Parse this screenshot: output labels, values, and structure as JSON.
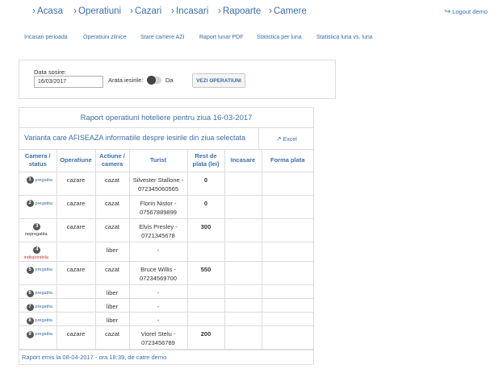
{
  "nav": {
    "items": [
      "Acasa",
      "Operatiuni",
      "Cazari",
      "Incasari",
      "Rapoarte",
      "Camere"
    ],
    "logout": "Logout demo"
  },
  "subnav": {
    "items": [
      "Incasari perioada",
      "Operatiuni zilnice",
      "Stare camere AZI",
      "Raport lunar PDF",
      "Statistica per luna",
      "Statistica luna vs. luna"
    ]
  },
  "filter": {
    "date_label": "Data sosire:",
    "date_value": "16/03/2017",
    "show_label": "Arata iesirile:",
    "toggle_label": "Da",
    "button_label": "VEZI OPERATIUNI"
  },
  "report": {
    "title": "Raport operatiuni hoteliere pentru ziua 16-03-2017",
    "variant_text": "Varianta care AFISEAZA informatiile despre iesirile din ziua selectata",
    "excel_label": "Excel",
    "headers": {
      "camera_status": "Camera / status",
      "operatiune": "Operatiune",
      "actiune_camera": "Actiune / camera",
      "turist": "Turist",
      "rest_plata": "Rest de plata (lei)",
      "incasare": "Incasare",
      "forma_plata": "Forma plata"
    },
    "rows": [
      {
        "num": "1",
        "status": "pregatita",
        "status_color": "#3b6fa8",
        "operatiune": "cazare",
        "actiune": "cazat",
        "turist": "Silvester Stallone - 072345060565",
        "rest": "0"
      },
      {
        "num": "2",
        "status": "pregatita",
        "status_color": "#3b6fa8",
        "operatiune": "cazare",
        "actiune": "cazat",
        "turist": "Florin Nistor - 07567889899",
        "rest": "0"
      },
      {
        "num": "3",
        "status": "nepregatita",
        "status_color": "#333333",
        "operatiune": "cazare",
        "actiune": "cazat",
        "turist": "Elvis Presley - 0721345678",
        "rest": "300"
      },
      {
        "num": "4",
        "status": "indisponibila",
        "status_color": "#c0392b",
        "operatiune": "",
        "actiune": "liber",
        "turist": "-",
        "rest": ""
      },
      {
        "num": "5",
        "status": "pregatita",
        "status_color": "#3b6fa8",
        "operatiune": "cazare",
        "actiune": "cazat",
        "turist": "Bruce Willis - 07234569700",
        "rest": "550"
      },
      {
        "num": "6",
        "status": "pregatita",
        "status_color": "#3b6fa8",
        "operatiune": "",
        "actiune": "liber",
        "turist": "-",
        "rest": ""
      },
      {
        "num": "7",
        "status": "pregatita",
        "status_color": "#3b6fa8",
        "operatiune": "",
        "actiune": "liber",
        "turist": "-",
        "rest": ""
      },
      {
        "num": "8",
        "status": "pregatita",
        "status_color": "#3b6fa8",
        "operatiune": "",
        "actiune": "liber",
        "turist": "-",
        "rest": ""
      },
      {
        "num": "9",
        "status": "pregatita",
        "status_color": "#3b6fa8",
        "operatiune": "cazare",
        "actiune": "cazat",
        "turist": "Viorel Stelu - 0723456789",
        "rest": "200"
      }
    ],
    "footer": "Raport emis la 08-04-2017 - ora 18:39, de catre demo"
  },
  "icons": {
    "nav_chevron": "chevron-right-icon",
    "logout": "logout-icon",
    "excel": "external-link-icon"
  },
  "colors": {
    "accent": "#3b6fa8",
    "status_red": "#c0392b",
    "border": "#dcdcdc"
  }
}
